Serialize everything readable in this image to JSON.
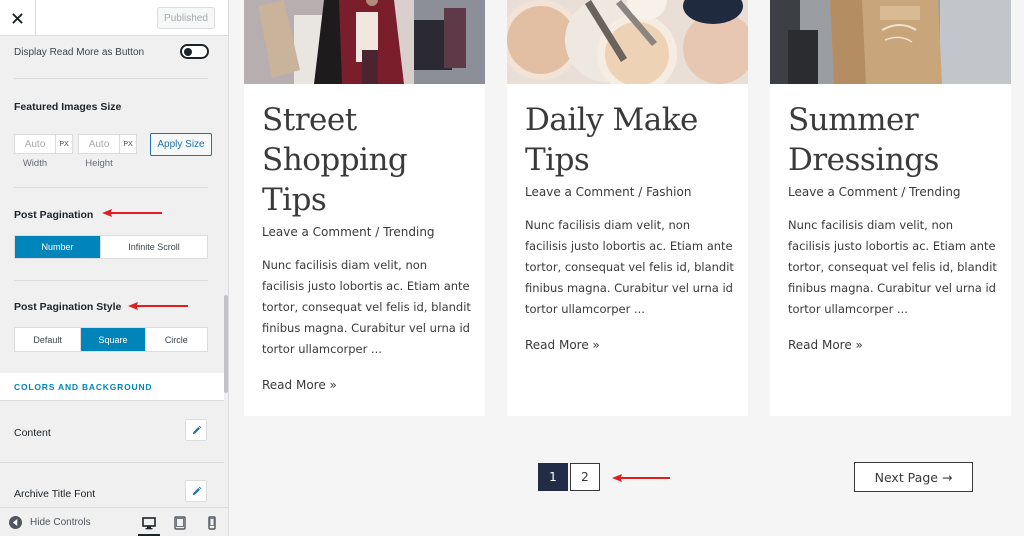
{
  "header": {
    "published_label": "Published"
  },
  "sidebar": {
    "read_more_button_label": "Display Read More as Button",
    "featured_images": {
      "title": "Featured Images Size",
      "width_value": "Auto",
      "height_value": "Auto",
      "unit": "PX",
      "width_caption": "Width",
      "height_caption": "Height",
      "apply_label": "Apply Size"
    },
    "post_pagination": {
      "title": "Post Pagination",
      "options": [
        "Number",
        "Infinite Scroll"
      ],
      "selected": "Number"
    },
    "post_pagination_style": {
      "title": "Post Pagination Style",
      "options": [
        "Default",
        "Square",
        "Circle"
      ],
      "selected": "Square"
    },
    "colors_section_title": "COLORS AND BACKGROUND",
    "content_label": "Content",
    "archive_title_font_label": "Archive Title Font",
    "footer": {
      "hide_controls_label": "Hide Controls"
    }
  },
  "posts": [
    {
      "title": "Street Shopping Tips",
      "meta": "Leave a Comment / Trending",
      "excerpt": "Nunc facilisis diam velit, non facilisis justo lobortis ac. Etiam ante tortor, consequat vel felis id, blandit finibus magna. Curabitur vel urna id tortor ullamcorper ...",
      "read_more": "Read More »"
    },
    {
      "title": "Daily Make Tips",
      "meta": "Leave a Comment / Fashion",
      "excerpt": "Nunc facilisis diam velit, non facilisis justo lobortis ac. Etiam ante tortor, consequat vel felis id, blandit finibus magna. Curabitur vel urna id tortor ullamcorper ...",
      "read_more": "Read More »"
    },
    {
      "title": "Summer Dressings",
      "meta": "Leave a Comment / Trending",
      "excerpt": "Nunc facilisis diam velit, non facilisis justo lobortis ac. Etiam ante tortor, consequat vel felis id, blandit finibus magna. Curabitur vel urna id tortor ullamcorper ...",
      "read_more": "Read More »"
    }
  ],
  "pagination": {
    "pages": [
      "1",
      "2"
    ],
    "current": "1",
    "next_label": "Next Page →"
  },
  "colors": {
    "accent": "#0085ba",
    "annotation_arrow": "#e02020",
    "pagination_current": "#232c46"
  },
  "icons": [
    "close-icon",
    "toggle",
    "pencil-icon",
    "arrow-left-circle-icon",
    "desktop-icon",
    "tablet-icon",
    "mobile-icon"
  ]
}
